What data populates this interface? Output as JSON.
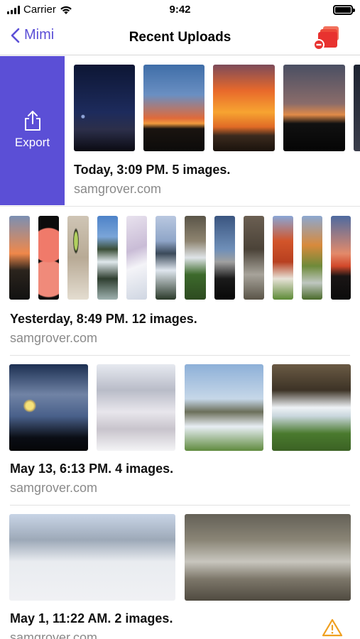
{
  "status_bar": {
    "carrier": "Carrier",
    "time": "9:42"
  },
  "nav": {
    "back_label": "Mimi",
    "title": "Recent Uploads",
    "accent_color": "#5b4fd6",
    "stack_icon_color": "#e8322f"
  },
  "swipe_action": {
    "label": "Export",
    "color": "#5b4fd6"
  },
  "uploads": [
    {
      "caption": "Today, 3:09 PM. 5 images.",
      "site": "samgrover.com"
    },
    {
      "caption": "Yesterday, 8:49 PM. 12 images.",
      "site": "samgrover.com"
    },
    {
      "caption": "May 13, 6:13 PM. 4 images.",
      "site": "samgrover.com"
    },
    {
      "caption": "May 1, 11:22 AM. 2 images.",
      "site": "samgrover.com"
    }
  ],
  "warning_icon": "warning-triangle-icon"
}
